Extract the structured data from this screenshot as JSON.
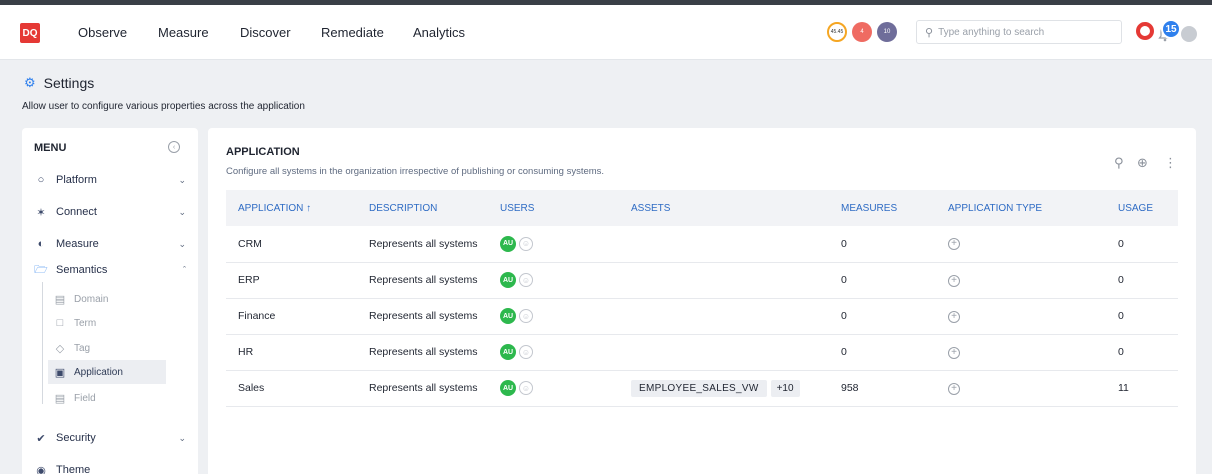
{
  "topbar": {
    "logo": "DQ",
    "nav": [
      "Observe",
      "Measure",
      "Discover",
      "Remediate",
      "Analytics"
    ],
    "score_badge": "45.45",
    "alerts_badge": "4",
    "issues_badge": "10",
    "search_placeholder": "Type anything to search",
    "notification_count": "15"
  },
  "page": {
    "title": "Settings",
    "subtitle": "Allow user to configure various properties across the application"
  },
  "sidebar": {
    "menu_title": "MENU",
    "items": [
      {
        "label": "Platform",
        "icon": "platform-icon"
      },
      {
        "label": "Connect",
        "icon": "connect-icon"
      },
      {
        "label": "Measure",
        "icon": "measure-icon"
      },
      {
        "label": "Semantics",
        "icon": "folder-icon"
      },
      {
        "label": "Security",
        "icon": "shield-icon"
      },
      {
        "label": "Theme",
        "icon": "palette-icon"
      }
    ],
    "semantics_sub": [
      {
        "label": "Domain",
        "icon": "domain-icon"
      },
      {
        "label": "Term",
        "icon": "file-icon"
      },
      {
        "label": "Tag",
        "icon": "tag-icon"
      },
      {
        "label": "Application",
        "icon": "application-icon"
      },
      {
        "label": "Field",
        "icon": "field-icon"
      }
    ]
  },
  "main": {
    "title": "APPLICATION",
    "description": "Configure all systems in the organization irrespective of publishing or consuming systems.",
    "columns": [
      "APPLICATION",
      "DESCRIPTION",
      "USERS",
      "ASSETS",
      "MEASURES",
      "APPLICATION TYPE",
      "USAGE"
    ],
    "sort_indicator": "↑",
    "rows": [
      {
        "name": "CRM",
        "description": "Represents all systems",
        "user": "AU",
        "asset": "",
        "asset_more": "",
        "measures": "0",
        "usage": "0"
      },
      {
        "name": "ERP",
        "description": "Represents all systems",
        "user": "AU",
        "asset": "",
        "asset_more": "",
        "measures": "0",
        "usage": "0"
      },
      {
        "name": "Finance",
        "description": "Represents all systems",
        "user": "AU",
        "asset": "",
        "asset_more": "",
        "measures": "0",
        "usage": "0"
      },
      {
        "name": "HR",
        "description": "Represents all systems",
        "user": "AU",
        "asset": "",
        "asset_more": "",
        "measures": "0",
        "usage": "0"
      },
      {
        "name": "Sales",
        "description": "Represents all systems",
        "user": "AU",
        "asset": "EMPLOYEE_SALES_VW",
        "asset_more": "+10",
        "measures": "958",
        "usage": "11"
      }
    ]
  },
  "colors": {
    "brand": "#e53935",
    "accent": "#2f80ed",
    "avatar": "#2db84d"
  }
}
